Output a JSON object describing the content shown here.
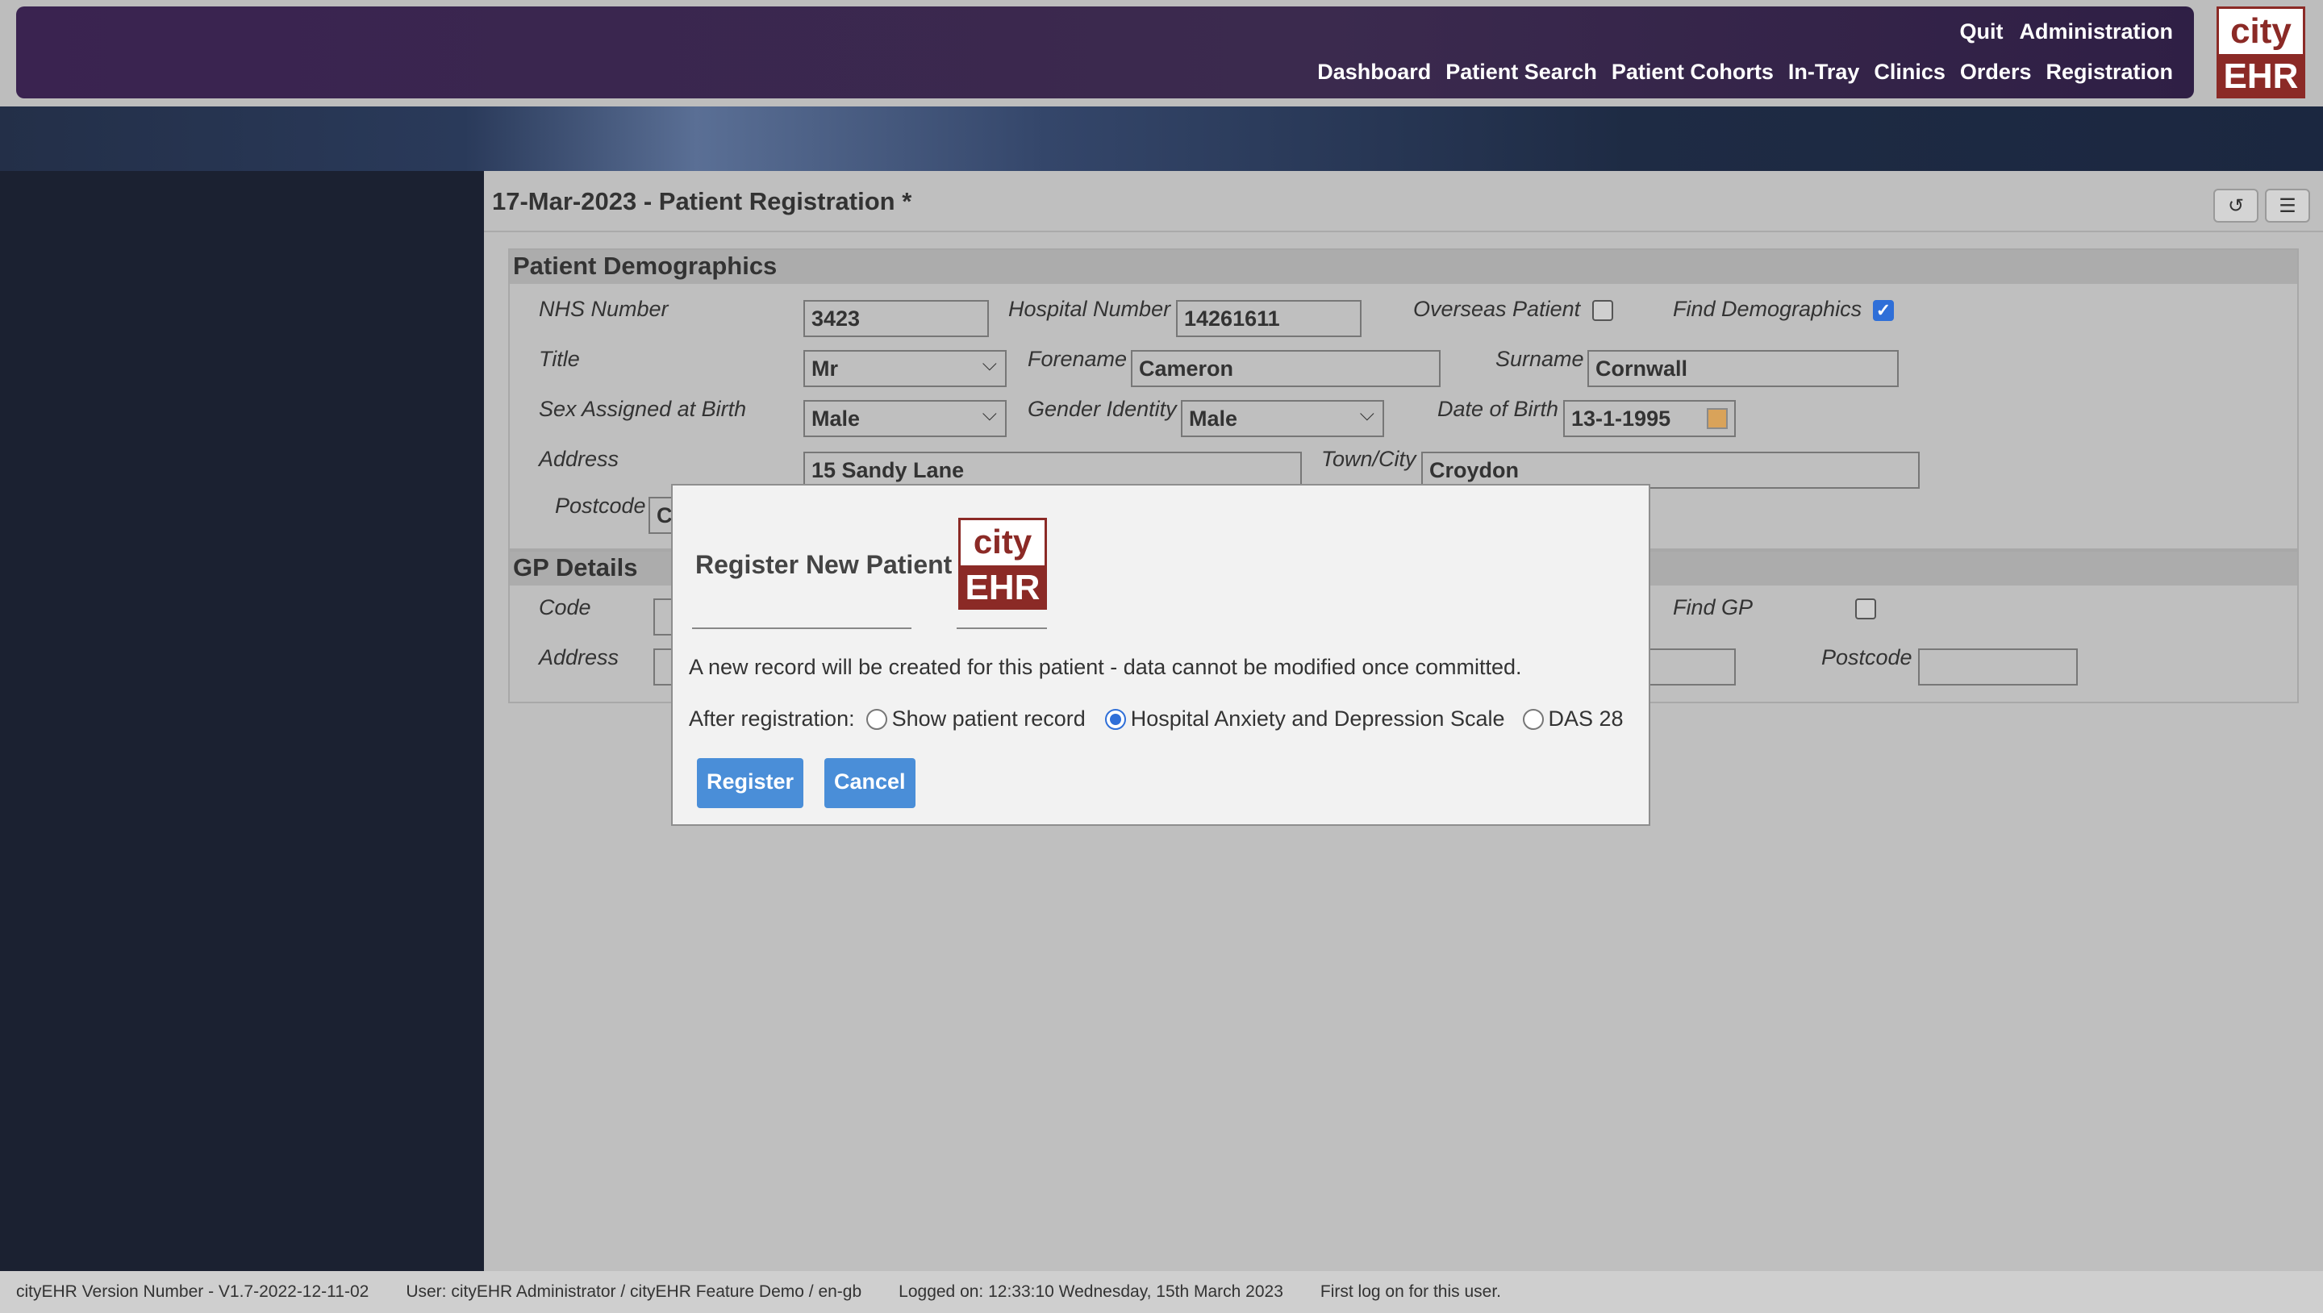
{
  "nav": {
    "top": [
      "Quit",
      "Administration"
    ],
    "main": [
      "Dashboard",
      "Patient Search",
      "Patient Cohorts",
      "In-Tray",
      "Clinics",
      "Orders",
      "Registration"
    ]
  },
  "logo": {
    "line1": "city",
    "line2": "EHR"
  },
  "page": {
    "title": "17-Mar-2023 - Patient Registration *",
    "tool_icons": [
      "refresh-icon",
      "list-icon"
    ]
  },
  "demographics": {
    "heading": "Patient Demographics",
    "nhs_label": "NHS Number",
    "nhs_value": "3423",
    "hospital_label": "Hospital Number",
    "hospital_value": "14261611",
    "overseas_label": "Overseas Patient",
    "overseas_checked": false,
    "find_label": "Find Demographics",
    "find_checked": true,
    "title_label": "Title",
    "title_value": "Mr",
    "forename_label": "Forename",
    "forename_value": "Cameron",
    "surname_label": "Surname",
    "surname_value": "Cornwall",
    "sex_label": "Sex Assigned at Birth",
    "sex_value": "Male",
    "gender_label": "Gender Identity",
    "gender_value": "Male",
    "dob_label": "Date of Birth",
    "dob_value": "13-1-1995",
    "address_label": "Address",
    "address_value": "15 Sandy Lane",
    "town_label": "Town/City",
    "town_value": "Croydon",
    "postcode_label": "Postcode",
    "postcode_value": "C"
  },
  "gp": {
    "heading": "GP Details",
    "code_label": "Code",
    "find_label": "Find GP",
    "find_checked": false,
    "address_label": "Address",
    "postcode_label": "Postcode"
  },
  "modal": {
    "title": "Register New Patient",
    "message": "A new record will be created for this patient - data cannot be modified once committed.",
    "after_label": "After registration:",
    "options": [
      "Show patient record",
      "Hospital Anxiety and Depression Scale",
      "DAS 28"
    ],
    "selected": "Hospital Anxiety and Depression Scale",
    "register_label": "Register",
    "cancel_label": "Cancel"
  },
  "status": {
    "version": "cityEHR Version Number - V1.7-2022-12-11-02",
    "user": "User: cityEHR Administrator / cityEHR Feature Demo / en-gb",
    "logged": "Logged on: 12:33:10 Wednesday, 15th March 2023",
    "first": "First log on for this user."
  },
  "colors": {
    "nav_purple": "#3a2350",
    "button_blue": "#4a8ed8",
    "logo_red": "#8b2a26",
    "check_blue": "#2f6fd8"
  }
}
